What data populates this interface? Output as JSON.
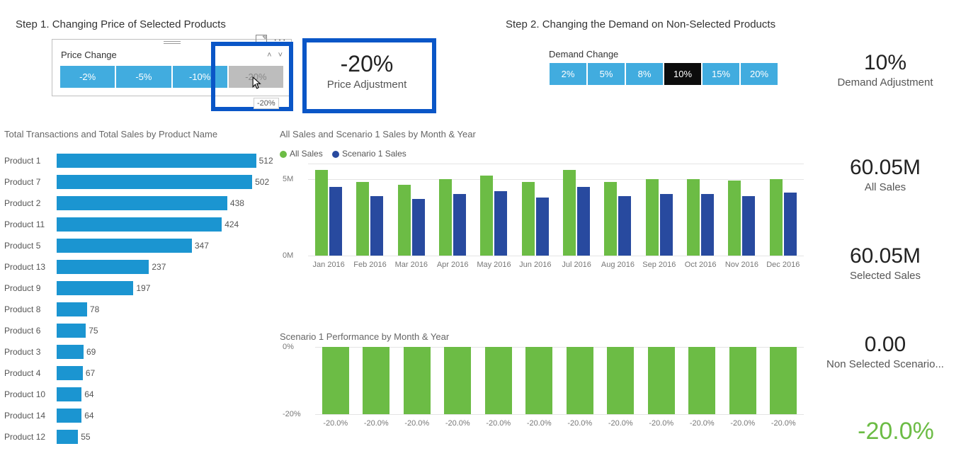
{
  "step1": {
    "title": "Step 1. Changing Price of Selected Products",
    "slicer_label": "Price Change",
    "items": [
      "-2%",
      "-5%",
      "-10%",
      "-20%"
    ],
    "selected": "-20%",
    "tooltip": "-20%"
  },
  "price_adj": {
    "value": "-20%",
    "label": "Price Adjustment"
  },
  "step2": {
    "title": "Step 2. Changing the Demand on Non-Selected Products",
    "slicer_label": "Demand Change",
    "items": [
      "2%",
      "5%",
      "8%",
      "10%",
      "15%",
      "20%"
    ],
    "selected": "10%"
  },
  "demand_adj": {
    "value": "10%",
    "label": "Demand Adjustment"
  },
  "kpi_all_sales": {
    "value": "60.05M",
    "label": "All Sales"
  },
  "kpi_sel_sales": {
    "value": "60.05M",
    "label": "Selected Sales"
  },
  "kpi_nonsel": {
    "value": "0.00",
    "label": "Non Selected Scenario..."
  },
  "kpi_bottom": {
    "value": "-20.0%"
  },
  "hbar": {
    "title": "Total Transactions and Total Sales by Product Name",
    "max": 520
  },
  "gcol": {
    "title": "All Sales and Scenario 1 Sales by Month & Year",
    "legend": {
      "a": "All Sales",
      "b": "Scenario 1 Sales"
    },
    "ylabels": {
      "y0": "0M",
      "y5": "5M"
    }
  },
  "scol": {
    "title": "Scenario 1 Performance by Month & Year",
    "ylabels": {
      "y0": "0%",
      "y20": "-20%"
    }
  },
  "chart_data": [
    {
      "id": "total_transactions_by_product",
      "type": "bar",
      "orientation": "horizontal",
      "title": "Total Transactions and Total Sales by Product Name",
      "categories": [
        "Product 1",
        "Product 7",
        "Product 2",
        "Product 11",
        "Product 5",
        "Product 13",
        "Product 9",
        "Product 8",
        "Product 6",
        "Product 3",
        "Product 4",
        "Product 10",
        "Product 14",
        "Product 12"
      ],
      "values": [
        512,
        502,
        438,
        424,
        347,
        237,
        197,
        78,
        75,
        69,
        67,
        64,
        64,
        55
      ],
      "xlabel": "",
      "ylabel": ""
    },
    {
      "id": "all_vs_scenario1_sales",
      "type": "bar",
      "title": "All Sales and Scenario 1 Sales by Month & Year",
      "categories": [
        "Jan 2016",
        "Feb 2016",
        "Mar 2016",
        "Apr 2016",
        "May 2016",
        "Jun 2016",
        "Jul 2016",
        "Aug 2016",
        "Sep 2016",
        "Oct 2016",
        "Nov 2016",
        "Dec 2016"
      ],
      "series": [
        {
          "name": "All Sales",
          "color": "#6cbc45",
          "values": [
            5.6,
            4.8,
            4.6,
            5.0,
            5.2,
            4.8,
            5.6,
            4.8,
            5.0,
            5.0,
            4.9,
            5.0
          ]
        },
        {
          "name": "Scenario 1 Sales",
          "color": "#284a9f",
          "values": [
            4.5,
            3.9,
            3.7,
            4.0,
            4.2,
            3.8,
            4.5,
            3.9,
            4.0,
            4.0,
            3.9,
            4.1
          ]
        }
      ],
      "ylabel": "",
      "ylim": [
        0,
        6
      ],
      "y_unit": "M"
    },
    {
      "id": "scenario1_performance",
      "type": "bar",
      "title": "Scenario 1 Performance by Month & Year",
      "categories": [
        "Jan 2016",
        "Feb 2016",
        "Mar 2016",
        "Apr 2016",
        "May 2016",
        "Jun 2016",
        "Jul 2016",
        "Aug 2016",
        "Sep 2016",
        "Oct 2016",
        "Nov 2016",
        "Dec 2016"
      ],
      "values": [
        -20.0,
        -20.0,
        -20.0,
        -20.0,
        -20.0,
        -20.0,
        -20.0,
        -20.0,
        -20.0,
        -20.0,
        -20.0,
        -20.0
      ],
      "data_labels": [
        "-20.0%",
        "-20.0%",
        "-20.0%",
        "-20.0%",
        "-20.0%",
        "-20.0%",
        "-20.0%",
        "-20.0%",
        "-20.0%",
        "-20.0%",
        "-20.0%",
        "-20.0%"
      ],
      "ylim": [
        -20,
        0
      ],
      "y_unit": "%"
    }
  ]
}
